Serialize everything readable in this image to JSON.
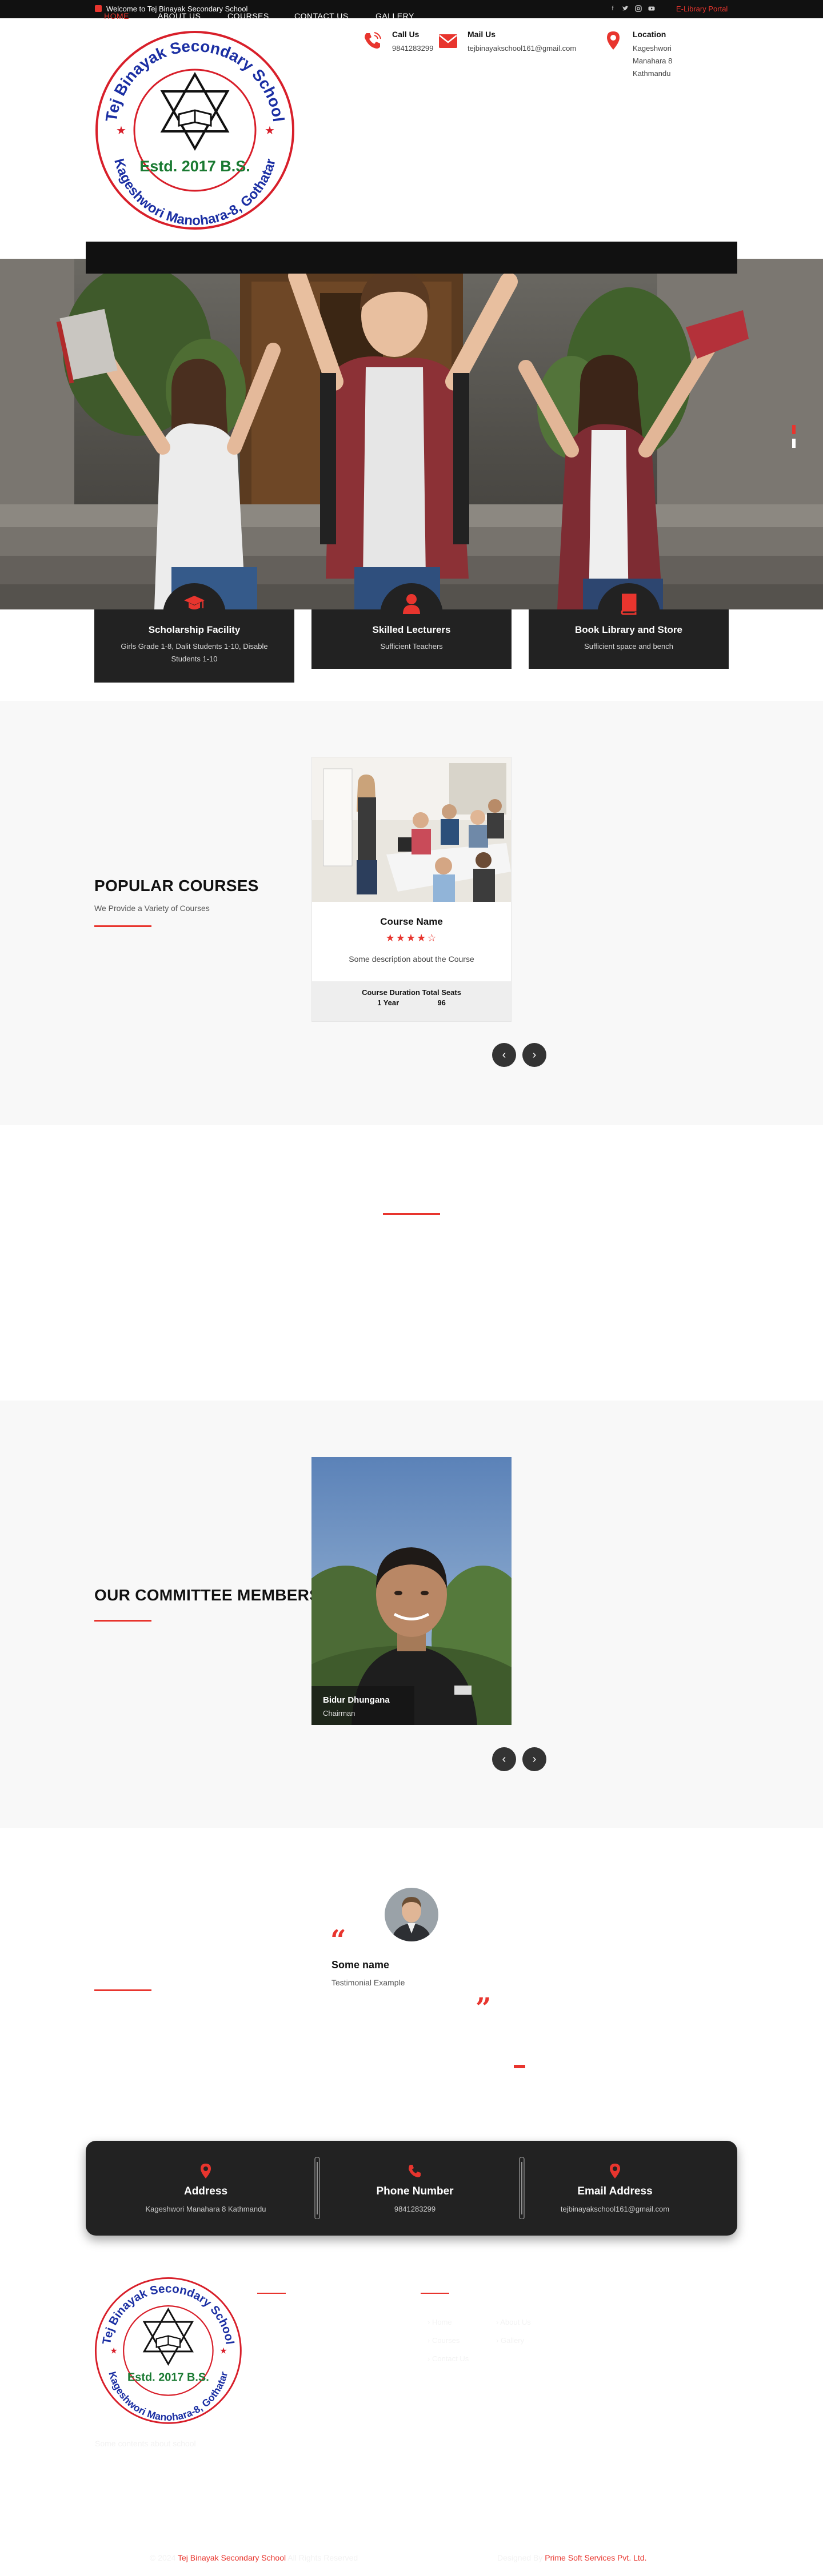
{
  "topbar": {
    "welcome": "Welcome to Tej Binayak Secondary School",
    "social_icons": [
      "facebook-icon",
      "twitter-icon",
      "instagram-icon",
      "youtube-icon"
    ],
    "elibrary_link": "E-Library Portal"
  },
  "logo": {
    "school_name_arc": "Tej Binayak Secondary School",
    "established": "Estd. 2017 B.S.",
    "address_arc": "Kageshwori Manohara-8, Gothatar"
  },
  "header_contacts": [
    {
      "icon": "phone-icon",
      "title": "Call Us",
      "text": "9841283299"
    },
    {
      "icon": "mail-icon",
      "title": "Mail Us",
      "text": "tejbinayakschool161@gmail.com"
    },
    {
      "icon": "location-icon",
      "title": "Location",
      "text": "Kageshwori Manahara 8 Kathmandu"
    }
  ],
  "nav": {
    "items": [
      "HOME",
      "ABOUT US",
      "COURSES",
      "CONTACT US",
      "GALLERY"
    ],
    "active": "HOME"
  },
  "features": [
    {
      "icon": "graduation-cap-icon",
      "title": "Scholarship Facility",
      "text": "Girls Grade 1-8, Dalit Students 1-10, Disable Students 1-10"
    },
    {
      "icon": "user-icon",
      "title": "Skilled Lecturers",
      "text": "Sufficient Teachers"
    },
    {
      "icon": "book-icon",
      "title": "Book Library and Store",
      "text": "Sufficient space and bench"
    }
  ],
  "courses": {
    "title": "POPULAR COURSES",
    "subtitle": "We Provide a Variety of Courses",
    "card": {
      "name": "Course Name",
      "rating": 4.5,
      "stars": "★★★★☆",
      "description": "Some description about the Course",
      "meta_header": "Course Duration Total Seats",
      "duration": "1 Year",
      "seats": "96"
    },
    "prev": "‹",
    "next": "›"
  },
  "committee": {
    "title": "OUR COMMITTEE MEMBERS",
    "member": {
      "name": "Bidur Dhungana",
      "role": "Chairman"
    },
    "prev": "‹",
    "next": "›"
  },
  "testimonial": {
    "name": "Some name",
    "text": "Testimonial Example",
    "quote_open": "“",
    "quote_close": "”"
  },
  "contact_strip": [
    {
      "icon": "location-icon",
      "title": "Address",
      "text": "Kageshwori Manahara 8 Kathmandu"
    },
    {
      "icon": "phone-icon",
      "title": "Phone Number",
      "text": "9841283299"
    },
    {
      "icon": "location-icon",
      "title": "Email Address",
      "text": "tejbinayakschool161@gmail.com"
    }
  ],
  "footer": {
    "links_col1": [
      "Home",
      "Courses",
      "Contact Us"
    ],
    "links_col2": [
      "About Us",
      "Gallery"
    ],
    "about": "Some contents about school",
    "copyright_prefix": "© 2024",
    "copyright_brand": "Tej Binayak Secondary School",
    "copyright_suffix": "All Rights Reserved",
    "credit_prefix": "Designed By",
    "credit_brand": "Prime Soft Services Pvt. Ltd."
  },
  "colors": {
    "accent": "#e8352e",
    "dark": "#222222",
    "topbar": "#111111",
    "section_bg": "#f8f8f8"
  }
}
